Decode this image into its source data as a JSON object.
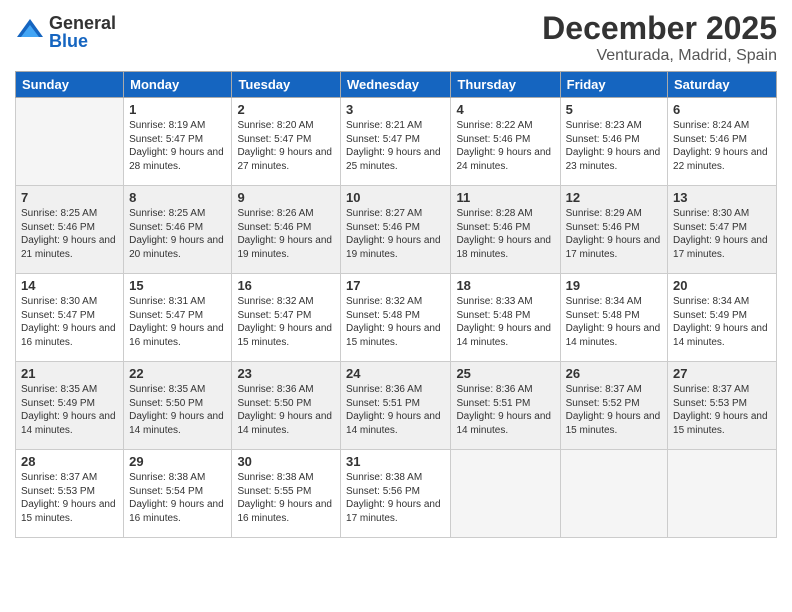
{
  "logo": {
    "general": "General",
    "blue": "Blue"
  },
  "title": "December 2025",
  "location": "Venturada, Madrid, Spain",
  "days_of_week": [
    "Sunday",
    "Monday",
    "Tuesday",
    "Wednesday",
    "Thursday",
    "Friday",
    "Saturday"
  ],
  "weeks": [
    [
      {
        "day": "",
        "sunrise": "",
        "sunset": "",
        "daylight": "",
        "empty": true
      },
      {
        "day": "1",
        "sunrise": "Sunrise: 8:19 AM",
        "sunset": "Sunset: 5:47 PM",
        "daylight": "Daylight: 9 hours and 28 minutes."
      },
      {
        "day": "2",
        "sunrise": "Sunrise: 8:20 AM",
        "sunset": "Sunset: 5:47 PM",
        "daylight": "Daylight: 9 hours and 27 minutes."
      },
      {
        "day": "3",
        "sunrise": "Sunrise: 8:21 AM",
        "sunset": "Sunset: 5:47 PM",
        "daylight": "Daylight: 9 hours and 25 minutes."
      },
      {
        "day": "4",
        "sunrise": "Sunrise: 8:22 AM",
        "sunset": "Sunset: 5:46 PM",
        "daylight": "Daylight: 9 hours and 24 minutes."
      },
      {
        "day": "5",
        "sunrise": "Sunrise: 8:23 AM",
        "sunset": "Sunset: 5:46 PM",
        "daylight": "Daylight: 9 hours and 23 minutes."
      },
      {
        "day": "6",
        "sunrise": "Sunrise: 8:24 AM",
        "sunset": "Sunset: 5:46 PM",
        "daylight": "Daylight: 9 hours and 22 minutes."
      }
    ],
    [
      {
        "day": "7",
        "sunrise": "Sunrise: 8:25 AM",
        "sunset": "Sunset: 5:46 PM",
        "daylight": "Daylight: 9 hours and 21 minutes."
      },
      {
        "day": "8",
        "sunrise": "Sunrise: 8:25 AM",
        "sunset": "Sunset: 5:46 PM",
        "daylight": "Daylight: 9 hours and 20 minutes."
      },
      {
        "day": "9",
        "sunrise": "Sunrise: 8:26 AM",
        "sunset": "Sunset: 5:46 PM",
        "daylight": "Daylight: 9 hours and 19 minutes."
      },
      {
        "day": "10",
        "sunrise": "Sunrise: 8:27 AM",
        "sunset": "Sunset: 5:46 PM",
        "daylight": "Daylight: 9 hours and 19 minutes."
      },
      {
        "day": "11",
        "sunrise": "Sunrise: 8:28 AM",
        "sunset": "Sunset: 5:46 PM",
        "daylight": "Daylight: 9 hours and 18 minutes."
      },
      {
        "day": "12",
        "sunrise": "Sunrise: 8:29 AM",
        "sunset": "Sunset: 5:46 PM",
        "daylight": "Daylight: 9 hours and 17 minutes."
      },
      {
        "day": "13",
        "sunrise": "Sunrise: 8:30 AM",
        "sunset": "Sunset: 5:47 PM",
        "daylight": "Daylight: 9 hours and 17 minutes."
      }
    ],
    [
      {
        "day": "14",
        "sunrise": "Sunrise: 8:30 AM",
        "sunset": "Sunset: 5:47 PM",
        "daylight": "Daylight: 9 hours and 16 minutes."
      },
      {
        "day": "15",
        "sunrise": "Sunrise: 8:31 AM",
        "sunset": "Sunset: 5:47 PM",
        "daylight": "Daylight: 9 hours and 16 minutes."
      },
      {
        "day": "16",
        "sunrise": "Sunrise: 8:32 AM",
        "sunset": "Sunset: 5:47 PM",
        "daylight": "Daylight: 9 hours and 15 minutes."
      },
      {
        "day": "17",
        "sunrise": "Sunrise: 8:32 AM",
        "sunset": "Sunset: 5:48 PM",
        "daylight": "Daylight: 9 hours and 15 minutes."
      },
      {
        "day": "18",
        "sunrise": "Sunrise: 8:33 AM",
        "sunset": "Sunset: 5:48 PM",
        "daylight": "Daylight: 9 hours and 14 minutes."
      },
      {
        "day": "19",
        "sunrise": "Sunrise: 8:34 AM",
        "sunset": "Sunset: 5:48 PM",
        "daylight": "Daylight: 9 hours and 14 minutes."
      },
      {
        "day": "20",
        "sunrise": "Sunrise: 8:34 AM",
        "sunset": "Sunset: 5:49 PM",
        "daylight": "Daylight: 9 hours and 14 minutes."
      }
    ],
    [
      {
        "day": "21",
        "sunrise": "Sunrise: 8:35 AM",
        "sunset": "Sunset: 5:49 PM",
        "daylight": "Daylight: 9 hours and 14 minutes."
      },
      {
        "day": "22",
        "sunrise": "Sunrise: 8:35 AM",
        "sunset": "Sunset: 5:50 PM",
        "daylight": "Daylight: 9 hours and 14 minutes."
      },
      {
        "day": "23",
        "sunrise": "Sunrise: 8:36 AM",
        "sunset": "Sunset: 5:50 PM",
        "daylight": "Daylight: 9 hours and 14 minutes."
      },
      {
        "day": "24",
        "sunrise": "Sunrise: 8:36 AM",
        "sunset": "Sunset: 5:51 PM",
        "daylight": "Daylight: 9 hours and 14 minutes."
      },
      {
        "day": "25",
        "sunrise": "Sunrise: 8:36 AM",
        "sunset": "Sunset: 5:51 PM",
        "daylight": "Daylight: 9 hours and 14 minutes."
      },
      {
        "day": "26",
        "sunrise": "Sunrise: 8:37 AM",
        "sunset": "Sunset: 5:52 PM",
        "daylight": "Daylight: 9 hours and 15 minutes."
      },
      {
        "day": "27",
        "sunrise": "Sunrise: 8:37 AM",
        "sunset": "Sunset: 5:53 PM",
        "daylight": "Daylight: 9 hours and 15 minutes."
      }
    ],
    [
      {
        "day": "28",
        "sunrise": "Sunrise: 8:37 AM",
        "sunset": "Sunset: 5:53 PM",
        "daylight": "Daylight: 9 hours and 15 minutes."
      },
      {
        "day": "29",
        "sunrise": "Sunrise: 8:38 AM",
        "sunset": "Sunset: 5:54 PM",
        "daylight": "Daylight: 9 hours and 16 minutes."
      },
      {
        "day": "30",
        "sunrise": "Sunrise: 8:38 AM",
        "sunset": "Sunset: 5:55 PM",
        "daylight": "Daylight: 9 hours and 16 minutes."
      },
      {
        "day": "31",
        "sunrise": "Sunrise: 8:38 AM",
        "sunset": "Sunset: 5:56 PM",
        "daylight": "Daylight: 9 hours and 17 minutes."
      },
      {
        "day": "",
        "sunrise": "",
        "sunset": "",
        "daylight": "",
        "empty": true
      },
      {
        "day": "",
        "sunrise": "",
        "sunset": "",
        "daylight": "",
        "empty": true
      },
      {
        "day": "",
        "sunrise": "",
        "sunset": "",
        "daylight": "",
        "empty": true
      }
    ]
  ]
}
